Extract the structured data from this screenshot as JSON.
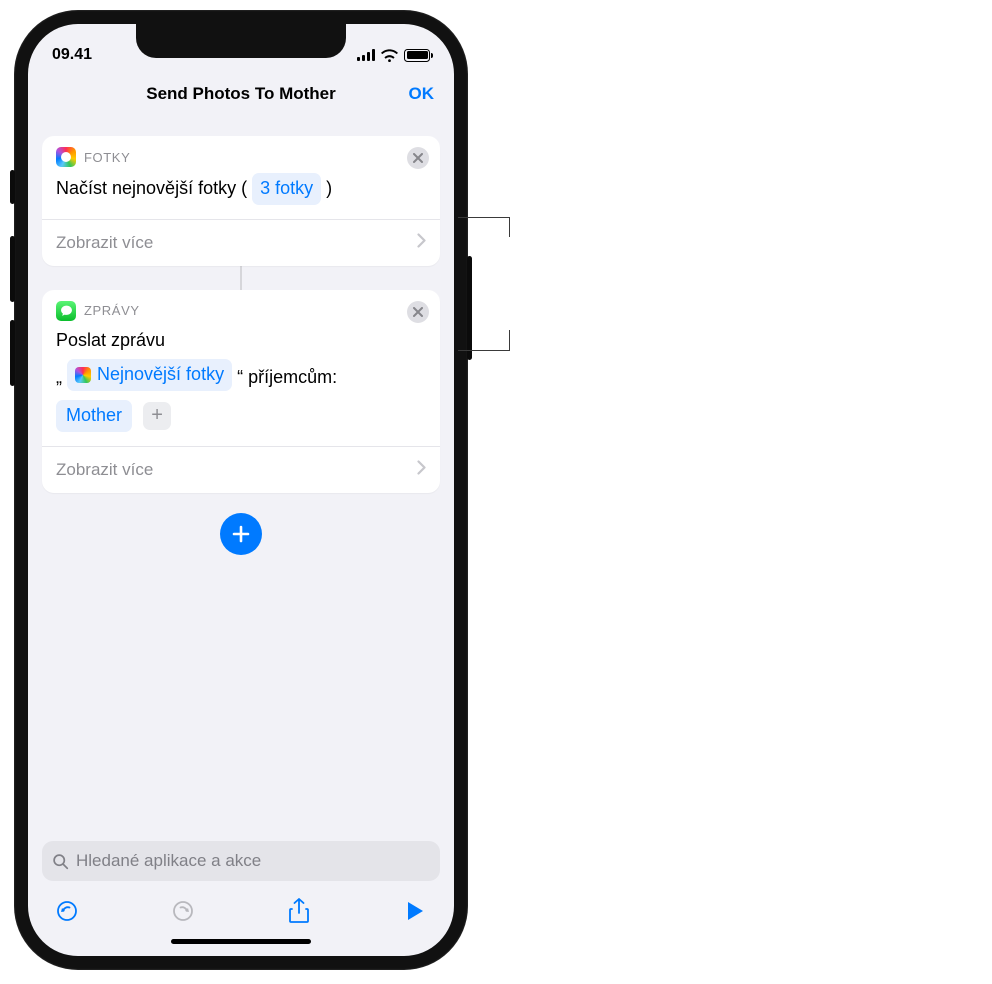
{
  "status": {
    "time": "09.41"
  },
  "nav": {
    "title": "Send Photos To Mother",
    "done": "OK"
  },
  "actions": [
    {
      "app": "FOTKY",
      "line_prefix": "Načíst nejnovější fotky (",
      "param": "3 fotky",
      "line_suffix": ")",
      "show_more": "Zobrazit více"
    },
    {
      "app": "ZPRÁVY",
      "line1": "Poslat zprávu",
      "quote_open": "„",
      "variable": "Nejnovější fotky",
      "quote_close": "“",
      "recipients_label": "příjemcům:",
      "recipient": "Mother",
      "show_more": "Zobrazit více"
    }
  ],
  "search": {
    "placeholder": "Hledané aplikace a akce"
  }
}
